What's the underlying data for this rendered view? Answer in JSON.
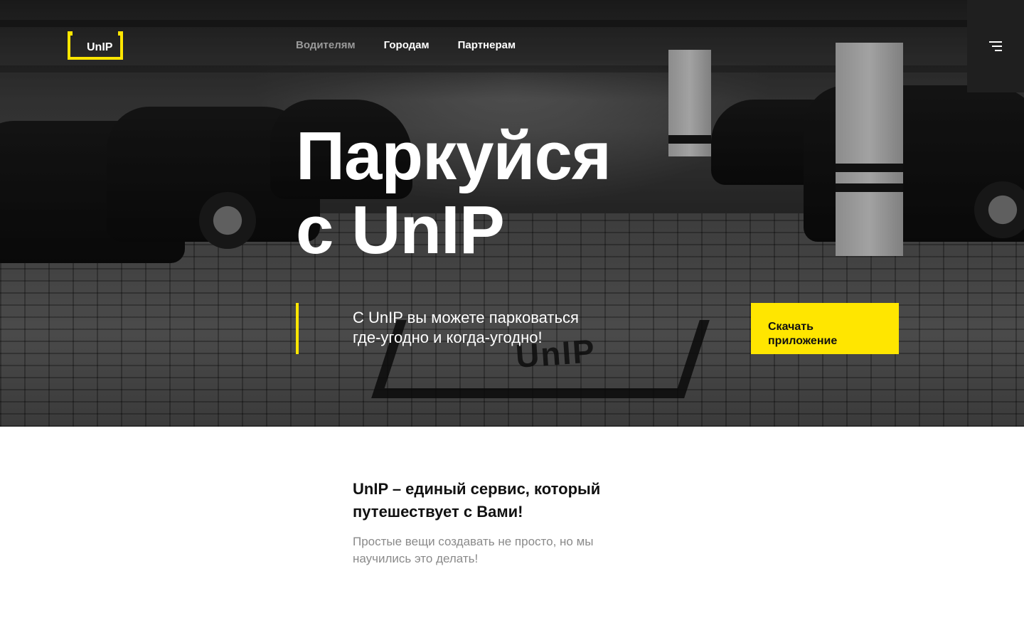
{
  "header": {
    "logo_text": "UnIP",
    "nav": [
      {
        "label": "Водителям",
        "active": false
      },
      {
        "label": "Городам",
        "active": true
      },
      {
        "label": "Партнерам",
        "active": true
      }
    ],
    "menu_icon": "hamburger-menu-icon"
  },
  "hero": {
    "title_lines": [
      "Паркуйся",
      "с UnIP"
    ],
    "subtitle_lines": [
      "С UnIP вы можете парковаться",
      "где-угодно и когда-угодно!"
    ],
    "cta_lines": [
      "Скачать",
      "приложение"
    ],
    "background_mark_text": "UnIP"
  },
  "info": {
    "heading_lines": [
      "UnIP – единый сервис, который",
      "путешествует с Вами!"
    ],
    "text_lines": [
      "Простые вещи создавать не просто, но мы",
      "научились это делать!"
    ]
  },
  "colors": {
    "accent": "#ffe600",
    "dark": "#1f1f1f",
    "muted_text": "#8a8a8a"
  }
}
